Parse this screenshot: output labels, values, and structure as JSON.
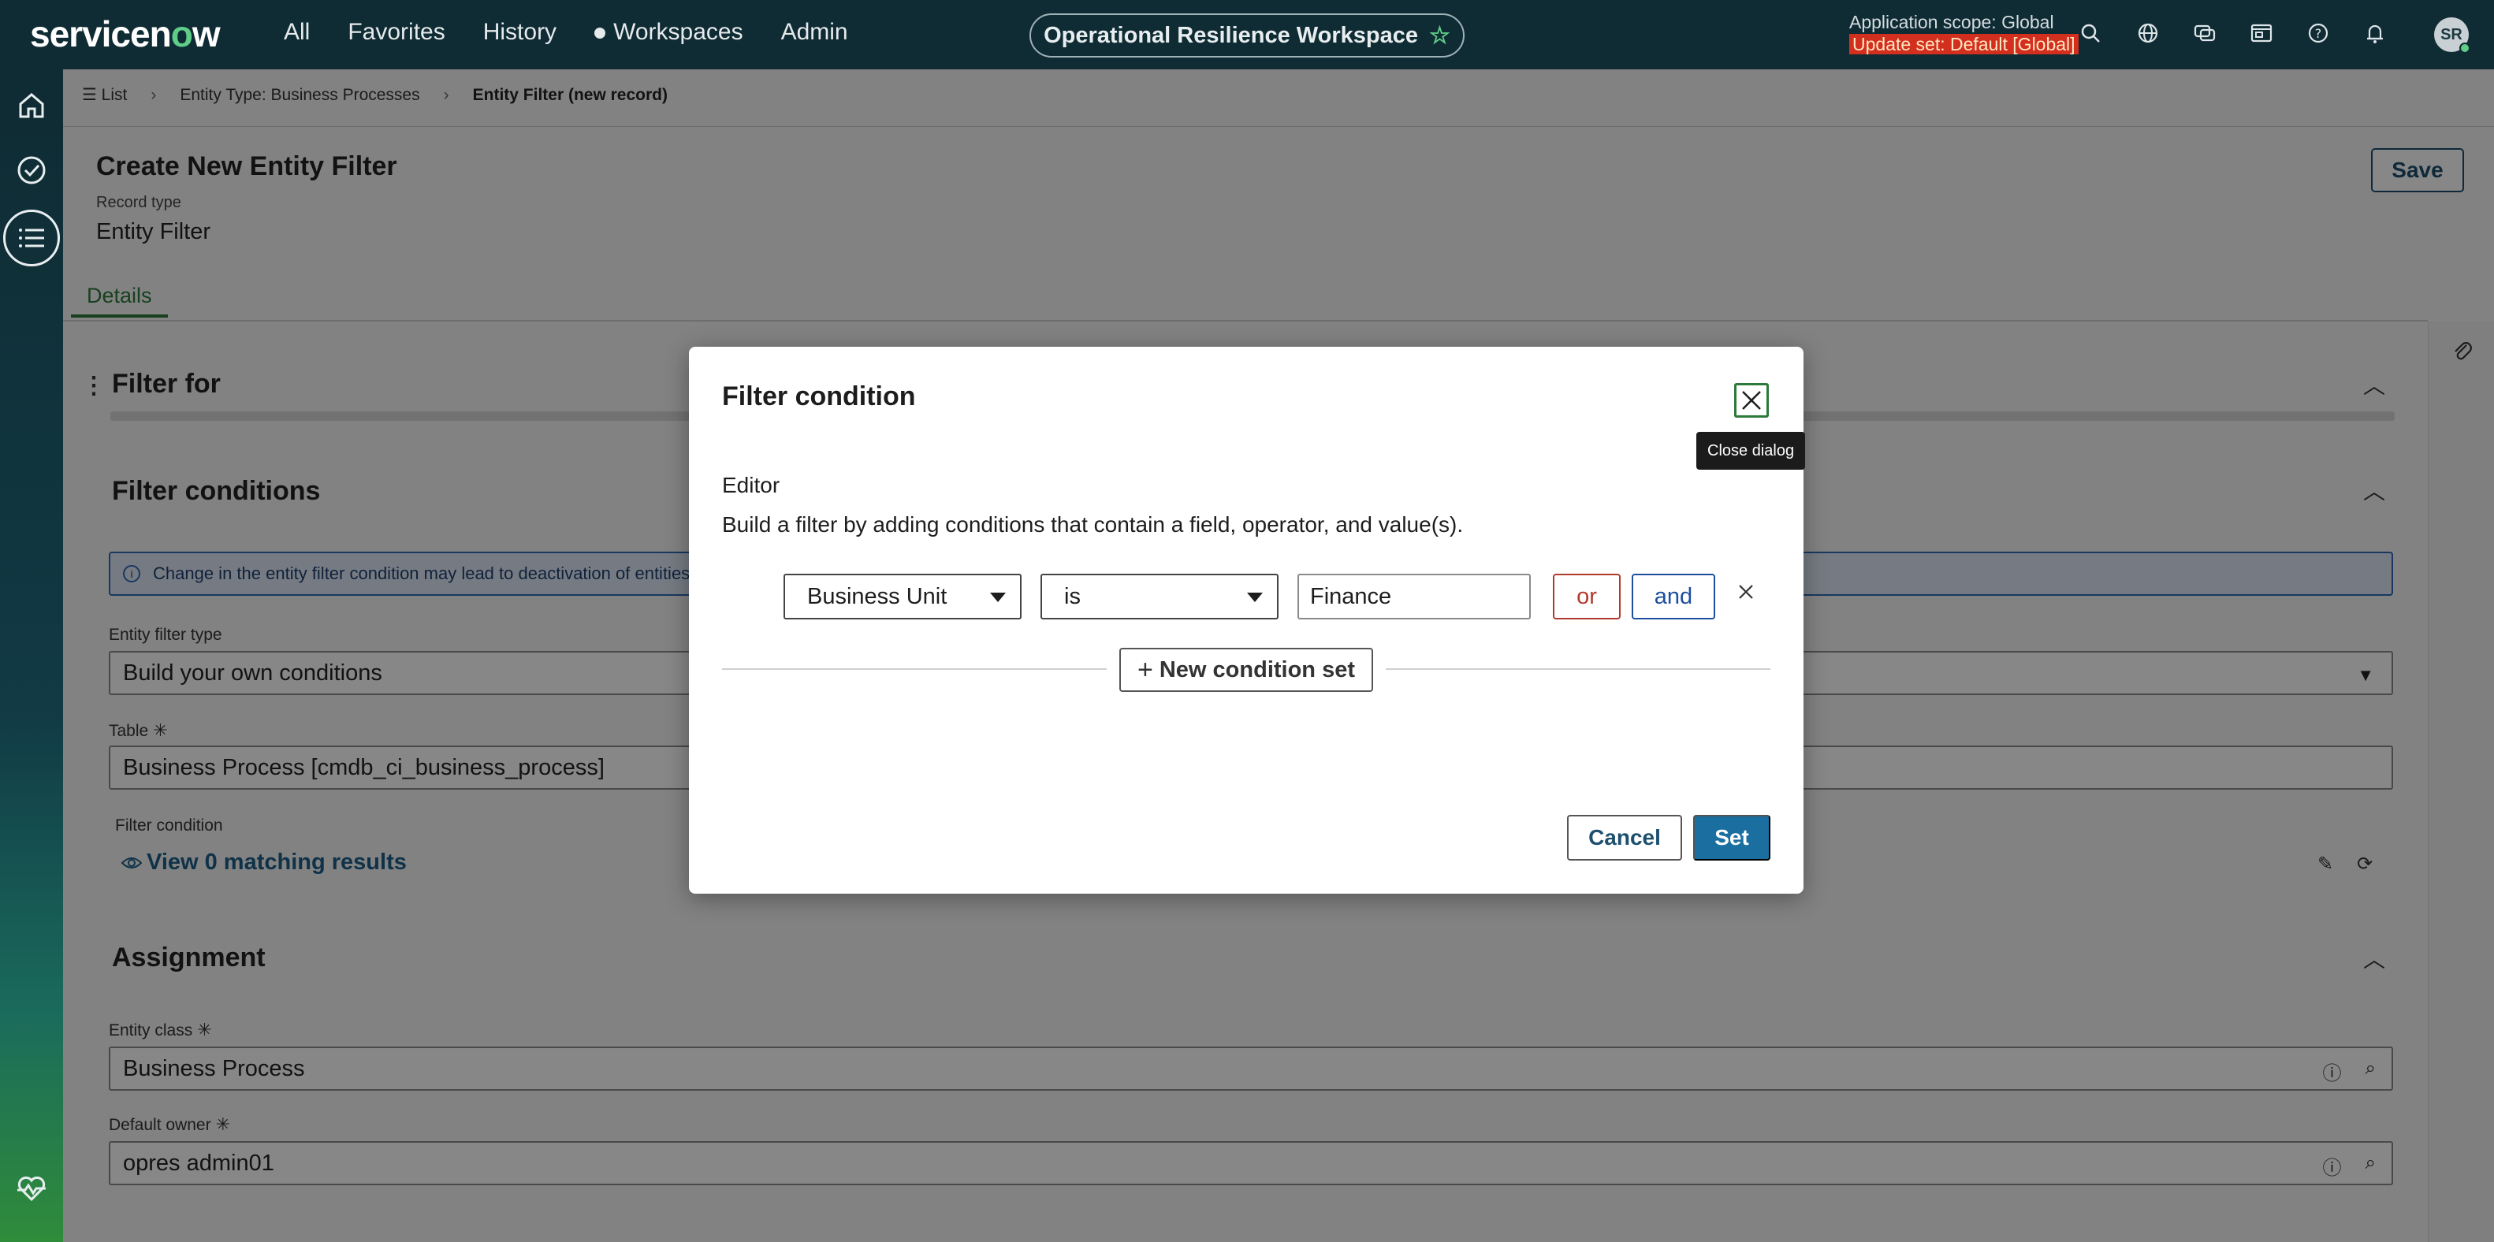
{
  "header": {
    "logo": "servicenow",
    "nav": [
      "All",
      "Favorites",
      "History",
      "Workspaces",
      "Admin"
    ],
    "workspace_title": "Operational Resilience Workspace",
    "scope_line": "Application scope: Global",
    "update_set": "Update set: Default [Global]",
    "avatar_initials": "SR",
    "icons": [
      "search-icon",
      "globe-icon",
      "chat-icon",
      "media-icon",
      "help-icon",
      "bell-icon"
    ]
  },
  "rail": {
    "icons": [
      "home-icon",
      "check-circle-icon",
      "list-icon",
      "heartbeat-icon"
    ]
  },
  "breadcrumb": {
    "list": "List",
    "entity_type": "Entity Type: Business Processes",
    "current": "Entity Filter (new record)"
  },
  "record": {
    "title": "Create New Entity Filter",
    "type_label": "Record type",
    "type_value": "Entity Filter",
    "save_label": "Save",
    "tab": "Details"
  },
  "sections": {
    "filter_for": "Filter for",
    "filter_conditions": "Filter conditions",
    "assignment": "Assignment"
  },
  "filter_conditions": {
    "info_text": "Change in the entity filter condition may lead to deactivation of entities. If",
    "entity_filter_type_label": "Entity filter type",
    "entity_filter_type_value": "Build your own conditions",
    "table_label": "Table",
    "table_value": "Business Process [cmdb_ci_business_process]",
    "filter_condition_label": "Filter condition",
    "view_results": "View 0 matching results"
  },
  "assignment": {
    "entity_class_label": "Entity class",
    "entity_class_value": "Business Process",
    "default_owner_label": "Default owner",
    "default_owner_value": "opres admin01"
  },
  "dialog": {
    "title": "Filter condition",
    "close_tooltip": "Close dialog",
    "editor_label": "Editor",
    "description": "Build a filter by adding conditions that contain a field, operator, and value(s).",
    "condition": {
      "field": "Business Unit",
      "operator": "is",
      "value": "Finance"
    },
    "or_label": "or",
    "and_label": "and",
    "new_condition_set": "New condition set",
    "cancel_label": "Cancel",
    "set_label": "Set"
  },
  "colors": {
    "header_bg": "#0f2b33",
    "accent_green": "#5fcc87",
    "primary_blue": "#1a6fa0",
    "or_red": "#b23a2c",
    "and_blue": "#1d4f9e",
    "update_set_bg": "#d32f1f"
  }
}
